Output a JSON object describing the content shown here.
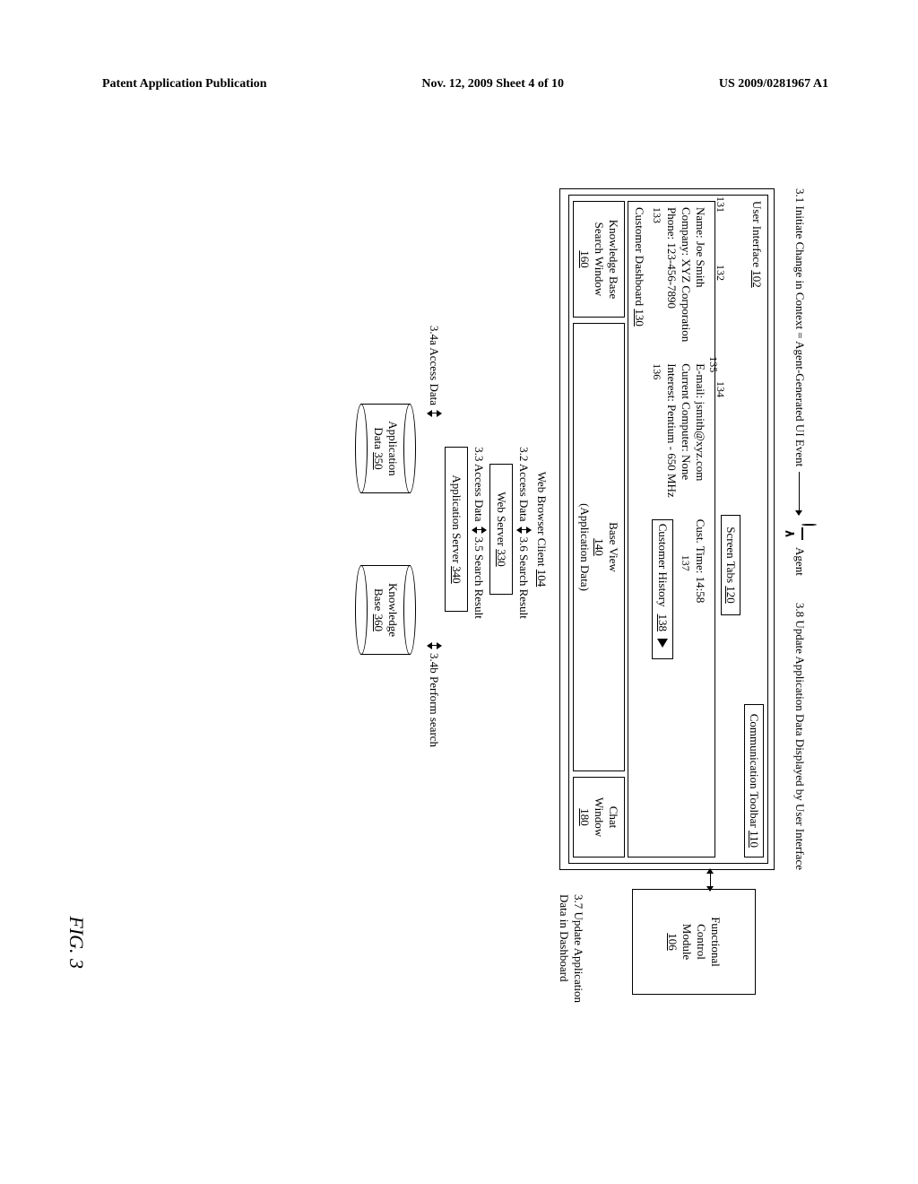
{
  "header": {
    "left": "Patent Application Publication",
    "center": "Nov. 12, 2009  Sheet 4 of 10",
    "right": "US 2009/0281967 A1"
  },
  "figure_label": "FIG. 3",
  "top": {
    "left": "3.1 Initiate Change in Context = Agent-Generated UI Event",
    "agent": "Agent",
    "right": "3.8 Update Application Data Displayed by User Interface"
  },
  "ui": {
    "title": "User Interface",
    "title_ref": "102",
    "comm_toolbar": "Communication Toolbar",
    "comm_toolbar_ref": "110",
    "screen_tabs": "Screen Tabs",
    "screen_tabs_ref": "120",
    "dash": {
      "ref_131": "131",
      "ref_132": "132",
      "ref_133": "133",
      "ref_134": "134",
      "ref_135": "135",
      "ref_136": "136",
      "ref_137": "137",
      "name": "Name: Joe Smith",
      "company": "Company: XYZ Corporation",
      "phone": "Phone: 123-456-7890",
      "email": "E-mail: jsmith@xyz.com",
      "curr_comp": "Current Computer: None",
      "interest": "Interest: Pentium - 650 MHz",
      "cust_time": "Cust. Time: 14:58",
      "title": "Customer Dashboard",
      "title_ref": "130",
      "history": "Customer History",
      "history_ref": "138"
    },
    "kb_search": {
      "l1": "Knowledge Base",
      "l2": "Search Window",
      "ref": "160"
    },
    "base_view": {
      "l1": "Base View",
      "ref": "140",
      "l3": "(Application Data)"
    },
    "chat": {
      "l1": "Chat",
      "l2": "Window",
      "ref": "180"
    }
  },
  "func": {
    "l1": "Functional",
    "l2": "Control",
    "l3": "Module",
    "ref": "106"
  },
  "stack": {
    "wbc": {
      "label": "Web Browser Client",
      "ref": "104"
    },
    "s32": "3.2 Access Data",
    "s36": "3.6 Search Result",
    "ws": {
      "label": "Web Server",
      "ref": "330"
    },
    "s33": "3.3 Access Data",
    "s35": "3.5 Search Result",
    "as": {
      "label": "Application Server",
      "ref": "340"
    },
    "s34a": "3.4a Access Data",
    "s34b": "3.4b Perform search",
    "app_data": {
      "l1": "Application",
      "l2": "Data",
      "ref": "350"
    },
    "kb": {
      "l1": "Knowledge",
      "l2": "Base",
      "ref": "360"
    }
  },
  "note37": "3.7 Update Application Data in Dashboard"
}
